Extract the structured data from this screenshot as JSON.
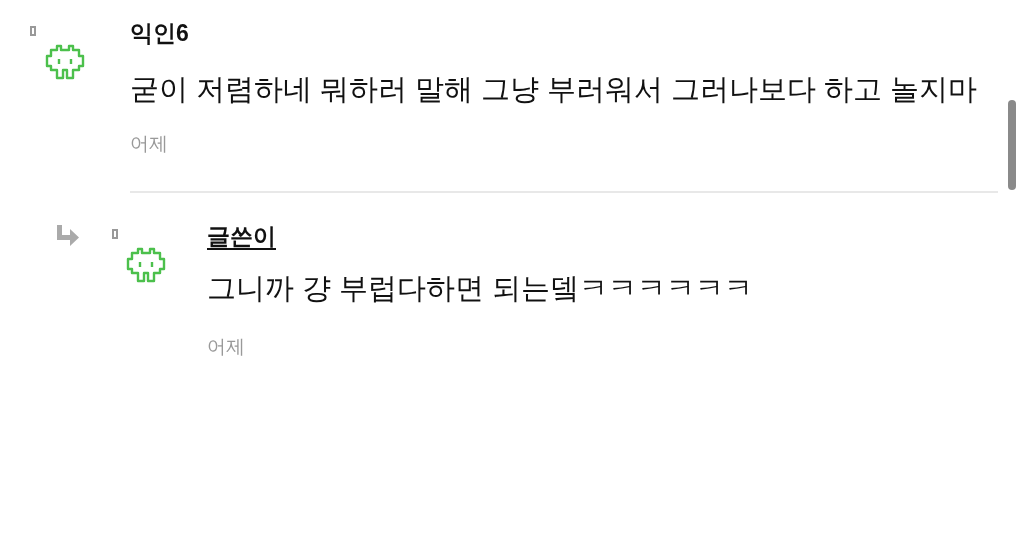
{
  "comments": [
    {
      "kind": "comment",
      "author": "익인6",
      "is_writer": false,
      "text": "굳이 저렴하네 뭐하러 말해 그냥 부러워서 그러나보다 하고 놀지마",
      "time": "어제"
    },
    {
      "kind": "reply",
      "author": "글쓴이",
      "is_writer": true,
      "text": "그니까 걍 부럽다하면 되는뎈ㅋㅋㅋㅋㅋㅋ",
      "time": "어제"
    }
  ]
}
